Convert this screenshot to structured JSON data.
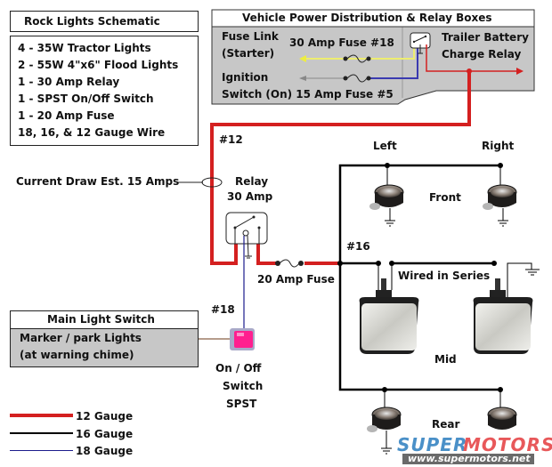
{
  "title_box": {
    "title": "Rock Lights Schematic"
  },
  "parts_list": [
    "4 - 35W Tractor Lights",
    "2 - 55W 4\"x6\" Flood Lights",
    "1 - 30 Amp Relay",
    "1 - SPST On/Off Switch",
    "1 - 20 Amp Fuse",
    "18, 16, & 12 Gauge Wire"
  ],
  "power_box": {
    "title": "Vehicle Power Distribution & Relay Boxes",
    "fuse_link": "Fuse Link",
    "starter": "(Starter)",
    "fuse_30": "30 Amp Fuse #18",
    "ignition": "Ignition",
    "switch_on": "Switch (On) 15 Amp Fuse #5",
    "trailer_relay_1": "Trailer Battery",
    "trailer_relay_2": "Charge Relay"
  },
  "labels": {
    "gauge12": "#12",
    "gauge16": "#16",
    "gauge18": "#18",
    "current_draw": "Current Draw Est. 15 Amps",
    "relay_1": "Relay",
    "relay_2": "30 Amp",
    "fuse_20": "20 Amp Fuse",
    "left": "Left",
    "right": "Right",
    "front": "Front",
    "wired_series": "Wired in Series",
    "mid": "Mid",
    "rear": "Rear",
    "switch_1": "On / Off",
    "switch_2": "Switch",
    "switch_3": "SPST"
  },
  "main_switch_box": {
    "title": "Main Light Switch",
    "line1": "Marker / park Lights",
    "line2": "(at warning chime)"
  },
  "legend": [
    {
      "label": "12 Gauge",
      "color": "#d42020"
    },
    {
      "label": "16 Gauge",
      "color": "#000000"
    },
    {
      "label": "18 Gauge",
      "color": "#1c1c8c"
    }
  ],
  "watermark": {
    "brand_a": "SUPER",
    "brand_b": "MOTORS",
    "url": "www.supermotors.net"
  },
  "colors": {
    "red_wire": "#d42020",
    "blue_wire": "#1c1c8c",
    "yellow_wire": "#eded70",
    "panel_grey": "#c7c7c7",
    "switch_pink": "#ff1f8f"
  }
}
